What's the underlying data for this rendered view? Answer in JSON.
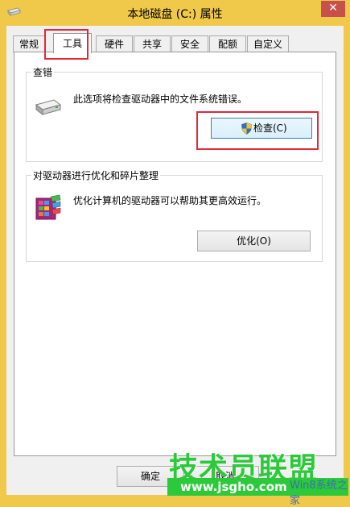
{
  "window": {
    "title": "本地磁盘 (C:) 属性",
    "close_glyph": "✕"
  },
  "tabs": [
    {
      "label": "常规"
    },
    {
      "label": "工具"
    },
    {
      "label": "硬件"
    },
    {
      "label": "共享"
    },
    {
      "label": "安全"
    },
    {
      "label": "配额"
    },
    {
      "label": "自定义"
    }
  ],
  "error_check": {
    "title": "查错",
    "description": "此选项将检查驱动器中的文件系统错误。",
    "button_label": "检查(C)",
    "icon": "drive-icon",
    "button_icon": "uac-shield-icon"
  },
  "optimize": {
    "title": "对驱动器进行优化和碎片整理",
    "description": "优化计算机的驱动器可以帮助其更高效运行。",
    "button_label": "优化(O)",
    "icon": "defrag-icon"
  },
  "footer": {
    "ok_label": "确定",
    "cancel_label": "取消"
  },
  "watermark": {
    "brand": "技术员联盟",
    "url": "www.jsgho.com",
    "sub": "Win8系统之家"
  },
  "colors": {
    "frame": "#f0c84a",
    "highlight": "#e0293b",
    "watermark": "#2cc93a"
  }
}
